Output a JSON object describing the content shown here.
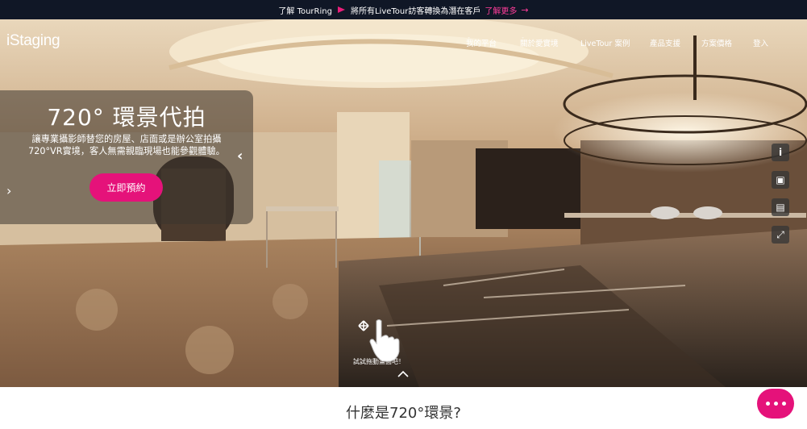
{
  "announcement": {
    "prefix": "了解 TourRing",
    "message": "將所有LiveTour訪客轉換為潛在客戶",
    "more_label": "了解更多",
    "arrow": "→",
    "accent_color": "#e91e7a"
  },
  "brand": {
    "logo_text": "iStaging"
  },
  "nav": {
    "items": [
      {
        "label": "我的平台",
        "has_dropdown": true
      },
      {
        "label": "關於愛實境",
        "has_dropdown": true
      },
      {
        "label": "LiveTour 案例",
        "has_dropdown": false
      },
      {
        "label": "產品支援",
        "has_dropdown": false
      },
      {
        "label": "方案價格",
        "has_dropdown": false
      },
      {
        "label": "登入",
        "has_dropdown": false
      }
    ],
    "caret": "˅"
  },
  "hero": {
    "title": "720°  環景代拍",
    "desc_line1": "讓專業攝影師替您的房屋、店面或是辦公室拍攝",
    "desc_line2": "720°VR實境，客人無需親臨現場也能參觀體驗。",
    "cta_label": "立即預約",
    "prev_arrow": "‹",
    "next_arrow": "›",
    "drag_hint": "試試拖動畫面吧！",
    "accent_color": "#e5127a"
  },
  "viewer_tools": [
    {
      "icon": "info-icon",
      "glyph": "i"
    },
    {
      "icon": "gallery-icon",
      "glyph": "▣"
    },
    {
      "icon": "floorplan-icon",
      "glyph": "▤"
    },
    {
      "icon": "fullscreen-icon",
      "glyph": "⤢"
    }
  ],
  "section": {
    "title": "什麼是720°環景?"
  },
  "chat": {
    "icon": "chat-dots-icon"
  }
}
